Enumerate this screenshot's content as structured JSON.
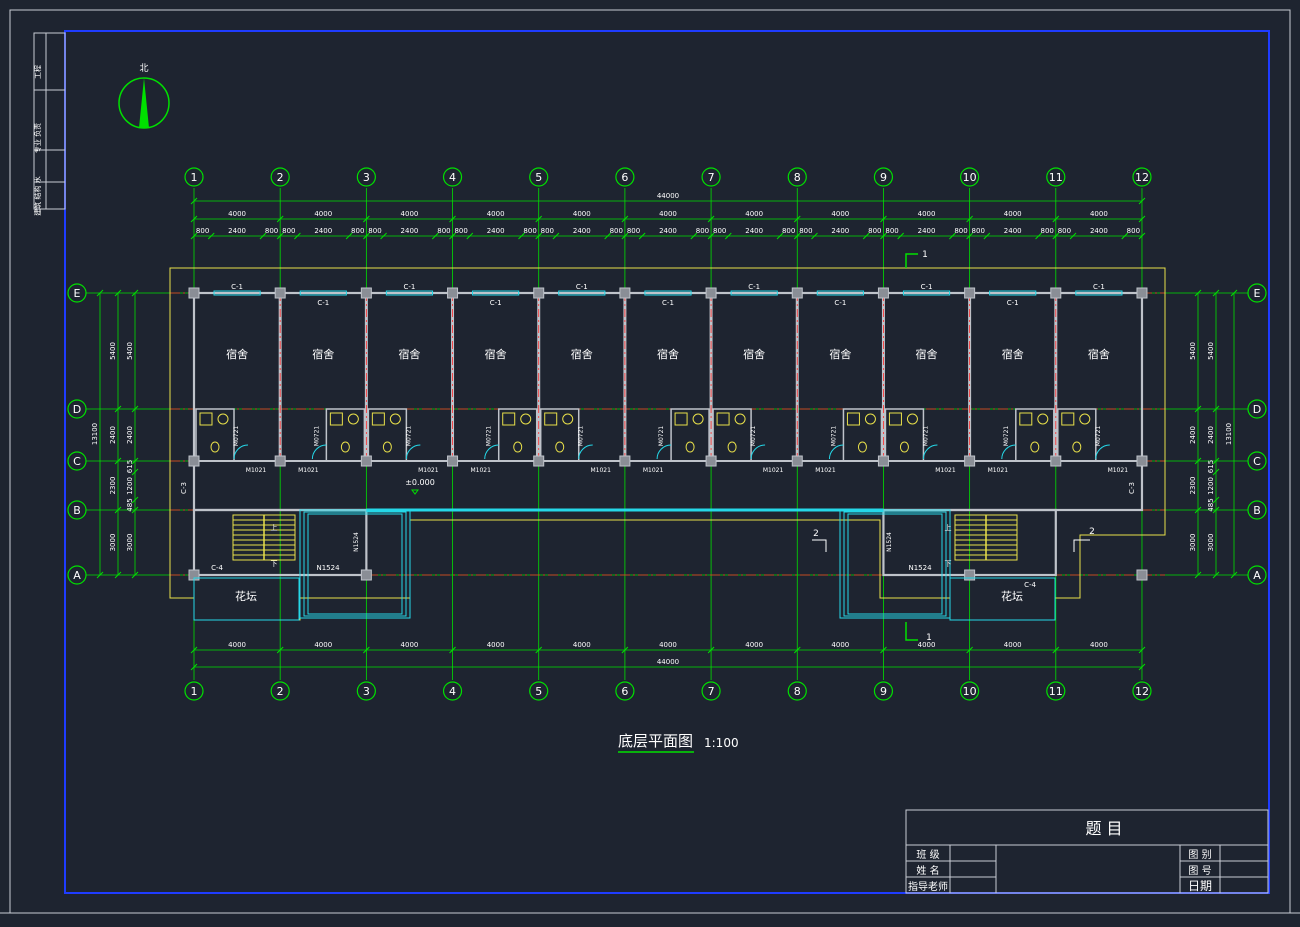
{
  "colors": {
    "background": "#1e2430",
    "frame_outer": "#c8ccd4",
    "frame_inner": "#1f3cff",
    "grid_axis": "#00e000",
    "axis_bubble": "#00e000",
    "wall": "#bfc3ca",
    "red_centerline": "#ff2a2a",
    "window": "#25d8e8",
    "door": "#25d8e8",
    "dimension_text": "#ffffff",
    "yellow_outline": "#e8e04a",
    "room_label": "#ffffff",
    "title_text": "#ffffff"
  },
  "north_arrow": {
    "label": "北",
    "icon": "north-arrow-icon"
  },
  "drawing": {
    "title": "底层平面图",
    "scale": "1:100"
  },
  "axes": {
    "columns": [
      "1",
      "2",
      "3",
      "4",
      "5",
      "6",
      "7",
      "8",
      "9",
      "10",
      "11",
      "12"
    ],
    "rows": [
      "E",
      "D",
      "C",
      "B",
      "A"
    ]
  },
  "dimensions": {
    "overall_top": "44000",
    "overall_bottom": "44000",
    "bay_top": [
      "4000",
      "4000",
      "4000",
      "4000",
      "4000",
      "4000",
      "4000",
      "4000",
      "4000",
      "4000",
      "4000"
    ],
    "bay_bottom": [
      "4000",
      "4000",
      "4000",
      "4000",
      "4000",
      "4000",
      "4000",
      "4000",
      "4000",
      "4000",
      "4000"
    ],
    "sub_pattern": [
      "800",
      "2400",
      "800"
    ],
    "left_outer": [
      "5400",
      "2400",
      "2300",
      "3000"
    ],
    "left_inner": [
      "5400",
      "2400",
      "615",
      "1200",
      "485",
      "3000"
    ],
    "left_total": "13100",
    "right_outer": [
      "5400",
      "2400",
      "2300",
      "3000"
    ],
    "right_inner": [
      "5400",
      "2400",
      "615",
      "1200",
      "485",
      "3000"
    ],
    "right_total": "13100"
  },
  "rooms": {
    "dorm_label": "宿舍",
    "dorm_count": 11,
    "planter_label": "花坛",
    "level_mark": "±0.000"
  },
  "tags": {
    "window_c1": "C-1",
    "window_c3": "C-3",
    "window_c4": "C-4",
    "door_m0721": "M0721",
    "door_m1021": "M1021",
    "door_n1524": "N1524",
    "stair_up": "上",
    "stair_down": "下",
    "section_1": "1",
    "section_2": "2"
  },
  "title_block": {
    "heading": "题 目",
    "left_rows": [
      "班 级",
      "姓 名",
      "指导老师"
    ],
    "right_rows": [
      "图 别",
      "图 号",
      "日期"
    ]
  },
  "side_strip": {
    "rows": [
      "工程",
      "专业 负责",
      "建筑 结构 水"
    ]
  }
}
